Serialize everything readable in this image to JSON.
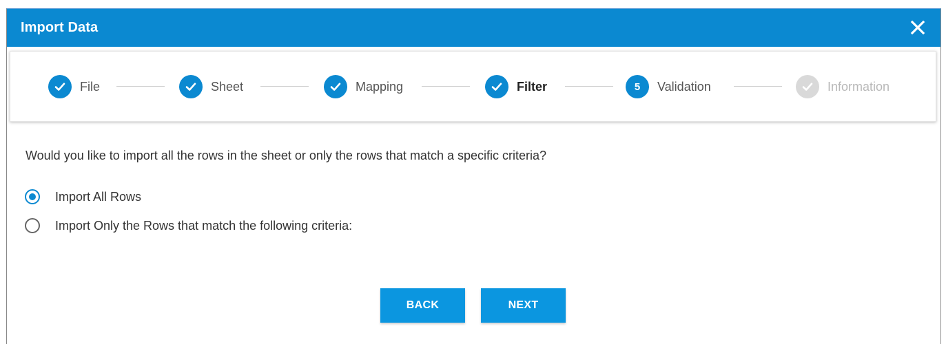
{
  "dialog": {
    "title": "Import Data"
  },
  "stepper": {
    "steps": [
      {
        "label": "File",
        "state": "done"
      },
      {
        "label": "Sheet",
        "state": "done"
      },
      {
        "label": "Mapping",
        "state": "done"
      },
      {
        "label": "Filter",
        "state": "active"
      },
      {
        "label": "Validation",
        "state": "current",
        "number": "5"
      },
      {
        "label": "Information",
        "state": "disabled"
      }
    ]
  },
  "content": {
    "question": "Would you like to import all the rows in the sheet or only the rows that match a specific criteria?",
    "options": [
      {
        "label": "Import All Rows",
        "selected": true
      },
      {
        "label": "Import Only the Rows that match the following criteria:",
        "selected": false
      }
    ]
  },
  "buttons": {
    "back_label": "BACK",
    "next_label": "NEXT"
  },
  "colors": {
    "accent": "#0b89d1",
    "button": "#0b96e0",
    "disabled": "#d9d9d9"
  },
  "icons": {
    "close": "close-icon",
    "check": "check-icon"
  }
}
